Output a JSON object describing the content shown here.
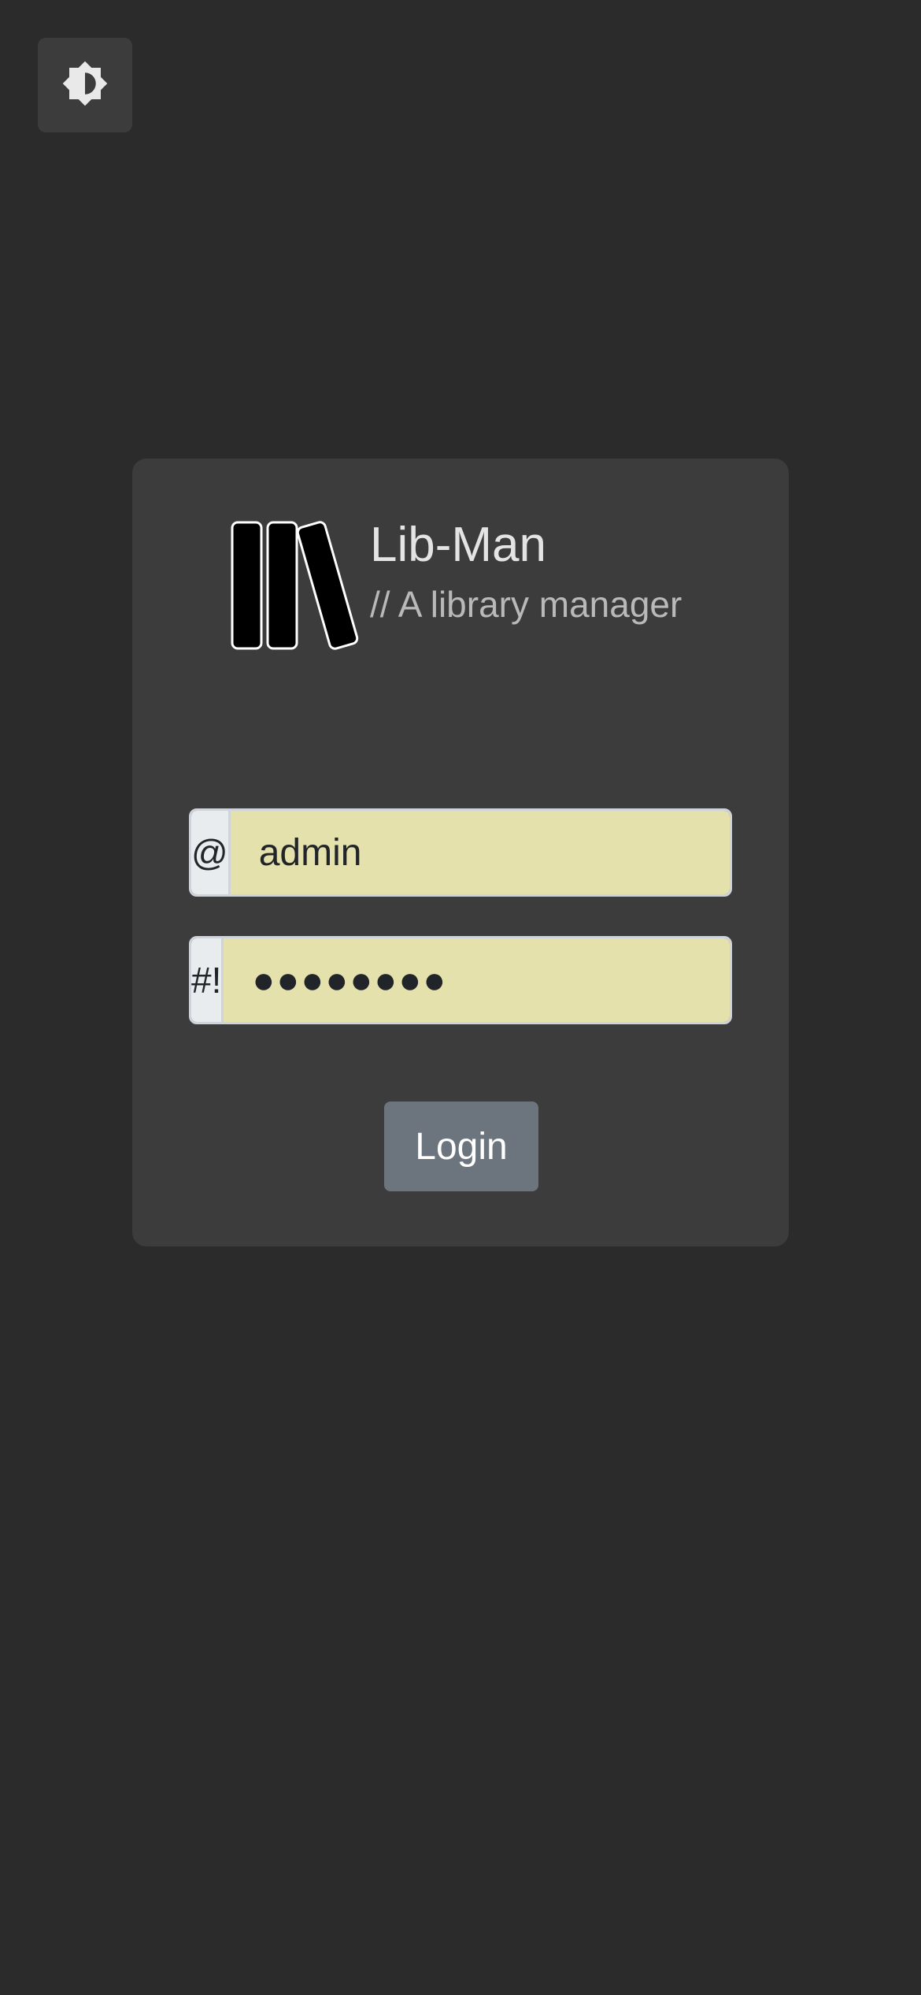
{
  "theme_toggle": {
    "icon": "brightness-contrast-icon"
  },
  "brand": {
    "title": "Lib-Man",
    "subtitle": "// A library manager",
    "logo_icon": "books-icon"
  },
  "login_form": {
    "username": {
      "addon": "@",
      "value": "admin"
    },
    "password": {
      "addon": "#!",
      "value": "●●●●●●●●"
    },
    "submit_label": "Login"
  },
  "colors": {
    "background": "#2b2b2b",
    "card": "#3c3c3c",
    "input_fill": "#e4e1ad",
    "button": "#6c757d"
  }
}
